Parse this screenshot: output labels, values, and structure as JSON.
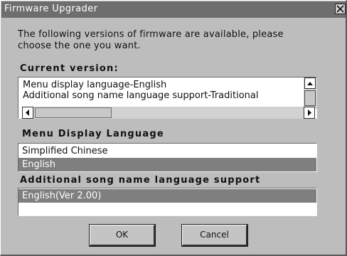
{
  "window": {
    "title": "Firmware Upgrader"
  },
  "intro": {
    "text": "The following versions of firmware are available, please choose the one you want."
  },
  "current_version": {
    "label": "Current version:",
    "lines": [
      "Menu display language-English",
      "Additional song name language support-Traditional"
    ]
  },
  "menu_language": {
    "label": "Menu Display Language",
    "items": [
      {
        "label": "Simplified Chinese",
        "selected": false
      },
      {
        "label": "English",
        "selected": true
      }
    ]
  },
  "song_language": {
    "label": "Additional song name language support",
    "items": [
      {
        "label": "English(Ver 2.00)",
        "selected": true
      }
    ]
  },
  "buttons": {
    "ok": "OK",
    "cancel": "Cancel"
  },
  "colors": {
    "title_bar": "#6e6e6e",
    "dialog_face": "#bdbdbd",
    "selection": "#7f7f7f"
  },
  "icons": {
    "close": "close-icon",
    "scroll_up": "arrow-up-icon",
    "scroll_left": "arrow-left-icon",
    "scroll_right": "arrow-right-icon"
  }
}
